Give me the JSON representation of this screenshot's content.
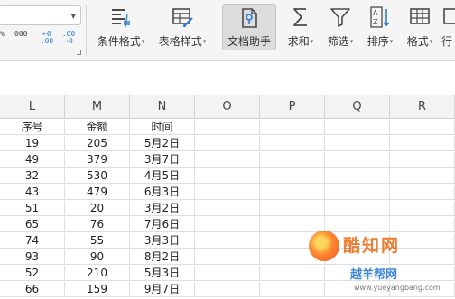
{
  "ribbon": {
    "number_format_arrow": "▾",
    "number_format_buttons": [
      {
        "name": "percent-style",
        "label": "%"
      },
      {
        "name": "thousands-separator",
        "label": "000"
      },
      {
        "name": "increase-decimal",
        "label": "←0 .00"
      },
      {
        "name": "decrease-decimal",
        "label": ".00 →0"
      }
    ],
    "buttons": [
      {
        "name": "conditional-format-button",
        "icon": "conditional-format-icon",
        "label": "条件格式",
        "dropdown": true
      },
      {
        "name": "table-style-button",
        "icon": "table-style-icon",
        "label": "表格样式",
        "dropdown": true
      },
      {
        "name": "doc-assistant-button",
        "icon": "doc-assistant-icon",
        "label": "文档助手",
        "dropdown": false,
        "active": true
      },
      {
        "name": "sum-button",
        "icon": "sigma-icon",
        "label": "求和",
        "dropdown": true
      },
      {
        "name": "filter-button",
        "icon": "filter-icon",
        "label": "筛选",
        "dropdown": true
      },
      {
        "name": "sort-button",
        "icon": "sort-icon",
        "label": "排序",
        "dropdown": true
      },
      {
        "name": "format-button",
        "icon": "format-icon",
        "label": "格式",
        "dropdown": true
      },
      {
        "name": "row-col-button",
        "icon": "row-col-icon",
        "label": "行",
        "dropdown": false
      }
    ],
    "dropdown_caret": "▾"
  },
  "sheet": {
    "columns": [
      "L",
      "M",
      "N",
      "O",
      "P",
      "Q",
      "R"
    ],
    "headers": [
      "序号",
      "金额",
      "时间"
    ],
    "rows": [
      [
        "19",
        "205",
        "5月2日"
      ],
      [
        "49",
        "379",
        "3月7日"
      ],
      [
        "32",
        "530",
        "4月5日"
      ],
      [
        "43",
        "479",
        "6月3日"
      ],
      [
        "51",
        "20",
        "3月2日"
      ],
      [
        "65",
        "76",
        "7月6日"
      ],
      [
        "74",
        "55",
        "3月3日"
      ],
      [
        "93",
        "90",
        "8月2日"
      ],
      [
        "52",
        "210",
        "5月3日"
      ],
      [
        "66",
        "159",
        "9月7日"
      ]
    ]
  },
  "watermark": {
    "title": "酷知网",
    "subtitle": "越羊帮网",
    "url": "www.yueyangbang.com"
  },
  "colors": {
    "accent_blue": "#2c7fd4",
    "ribbon_bg": "#f5f5f5",
    "active_button_bg": "#dcdcdc"
  }
}
